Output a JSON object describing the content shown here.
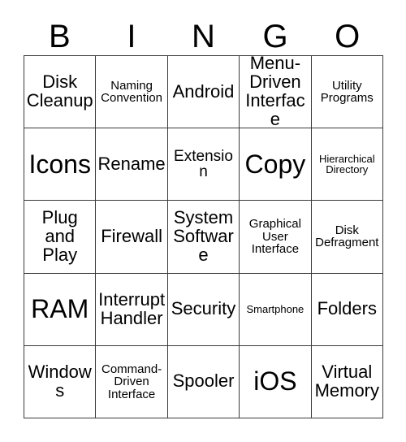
{
  "card": {
    "header_letters": [
      "B",
      "I",
      "N",
      "G",
      "O"
    ],
    "rows": [
      [
        {
          "text": "Disk\nCleanup",
          "size": "md"
        },
        {
          "text": "Naming\nConvention",
          "size": "xs"
        },
        {
          "text": "Android",
          "size": "md"
        },
        {
          "text": "Menu-\nDriven\nInterface",
          "size": "md"
        },
        {
          "text": "Utility\nPrograms",
          "size": "xs"
        }
      ],
      [
        {
          "text": "Icons",
          "size": "xl"
        },
        {
          "text": "Rename",
          "size": "md"
        },
        {
          "text": "Extension",
          "size": "sm"
        },
        {
          "text": "Copy",
          "size": "xl"
        },
        {
          "text": "Hierarchical\nDirectory",
          "size": "xxs"
        }
      ],
      [
        {
          "text": "Plug\nand\nPlay",
          "size": "md"
        },
        {
          "text": "Firewall",
          "size": "md"
        },
        {
          "text": "System\nSoftware",
          "size": "md"
        },
        {
          "text": "Graphical\nUser\nInterface",
          "size": "xs"
        },
        {
          "text": "Disk\nDefragment",
          "size": "xs"
        }
      ],
      [
        {
          "text": "RAM",
          "size": "xl"
        },
        {
          "text": "Interrupt\nHandler",
          "size": "md"
        },
        {
          "text": "Security",
          "size": "md"
        },
        {
          "text": "Smartphone",
          "size": "xxs"
        },
        {
          "text": "Folders",
          "size": "md"
        }
      ],
      [
        {
          "text": "Windows",
          "size": "md"
        },
        {
          "text": "Command-\nDriven\nInterface",
          "size": "xs"
        },
        {
          "text": "Spooler",
          "size": "md"
        },
        {
          "text": "iOS",
          "size": "xl"
        },
        {
          "text": "Virtual\nMemory",
          "size": "md"
        }
      ]
    ]
  },
  "colors": {
    "background": "#ffffff",
    "text": "#000000",
    "gridline": "#3a3a3a"
  }
}
